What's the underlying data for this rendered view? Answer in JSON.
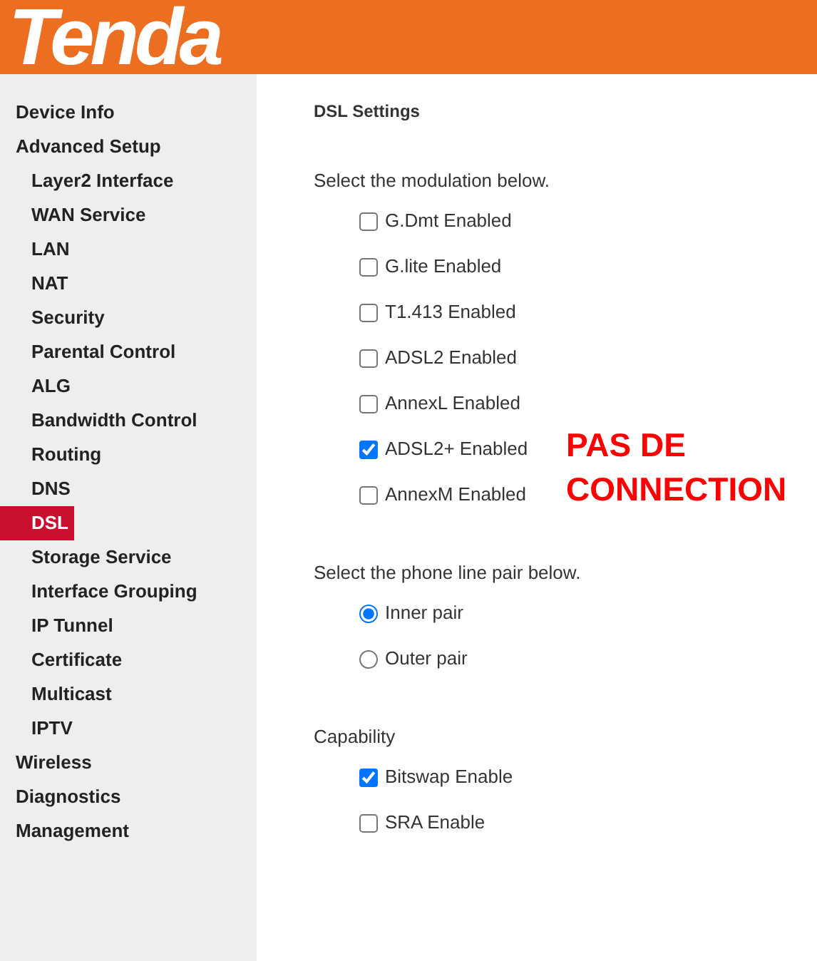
{
  "header": {
    "logo": "Tenda"
  },
  "sidebar": {
    "items": [
      {
        "label": "Device Info",
        "selected": false
      },
      {
        "label": "Advanced Setup",
        "selected": false,
        "children": [
          {
            "label": "Layer2 Interface",
            "selected": false
          },
          {
            "label": "WAN Service",
            "selected": false
          },
          {
            "label": "LAN",
            "selected": false
          },
          {
            "label": "NAT",
            "selected": false
          },
          {
            "label": "Security",
            "selected": false
          },
          {
            "label": "Parental Control",
            "selected": false
          },
          {
            "label": "ALG",
            "selected": false
          },
          {
            "label": "Bandwidth Control",
            "selected": false
          },
          {
            "label": "Routing",
            "selected": false
          },
          {
            "label": "DNS",
            "selected": false
          },
          {
            "label": "DSL",
            "selected": true
          },
          {
            "label": "Storage Service",
            "selected": false
          },
          {
            "label": "Interface Grouping",
            "selected": false
          },
          {
            "label": "IP Tunnel",
            "selected": false
          },
          {
            "label": "Certificate",
            "selected": false
          },
          {
            "label": "Multicast",
            "selected": false
          },
          {
            "label": "IPTV",
            "selected": false
          }
        ]
      },
      {
        "label": "Wireless",
        "selected": false
      },
      {
        "label": "Diagnostics",
        "selected": false
      },
      {
        "label": "Management",
        "selected": false
      }
    ]
  },
  "content": {
    "title": "DSL Settings",
    "sections": [
      {
        "label": "Select the modulation below.",
        "kind": "checkbox",
        "annotation": "PAS DE CONNECTION",
        "options": [
          {
            "label": "G.Dmt Enabled",
            "checked": false
          },
          {
            "label": "G.lite Enabled",
            "checked": false
          },
          {
            "label": "T1.413 Enabled",
            "checked": false
          },
          {
            "label": "ADSL2 Enabled",
            "checked": false
          },
          {
            "label": "AnnexL Enabled",
            "checked": false
          },
          {
            "label": "ADSL2+ Enabled",
            "checked": true
          },
          {
            "label": "AnnexM Enabled",
            "checked": false
          }
        ]
      },
      {
        "label": "Select the phone line pair below.",
        "kind": "radio",
        "options": [
          {
            "label": "Inner pair",
            "checked": true
          },
          {
            "label": "Outer pair",
            "checked": false
          }
        ]
      },
      {
        "label": "Capability",
        "kind": "checkbox",
        "options": [
          {
            "label": "Bitswap Enable",
            "checked": true
          },
          {
            "label": "SRA Enable",
            "checked": false
          }
        ]
      }
    ]
  }
}
